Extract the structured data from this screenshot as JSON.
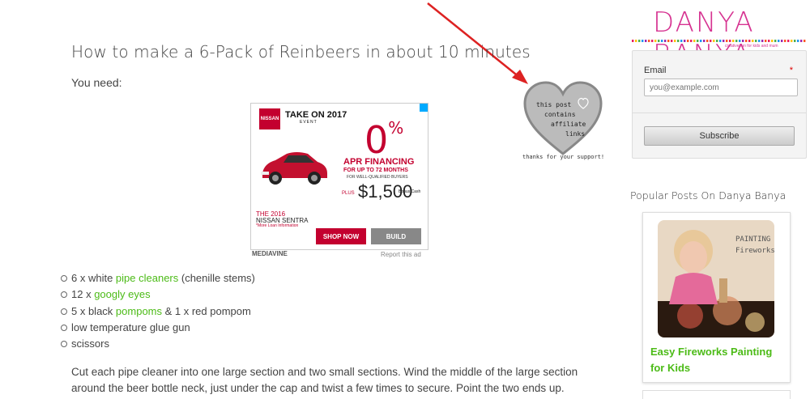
{
  "post": {
    "title": "How to make a 6-Pack of Reinbeers in about 10 minutes",
    "you_need": "You need:",
    "supplies": [
      {
        "prefix": "6 x white ",
        "link": "pipe cleaners",
        "suffix": " (chenille stems)"
      },
      {
        "prefix": "12 x ",
        "link": "googly eyes",
        "suffix": ""
      },
      {
        "prefix": "5 x black ",
        "link": "pompoms",
        "suffix": " & 1 x red pompom"
      },
      {
        "prefix": "low temperature glue gun",
        "link": "",
        "suffix": ""
      },
      {
        "prefix": "scissors",
        "link": "",
        "suffix": ""
      }
    ],
    "paragraph": "Cut each pipe cleaner into one large section and two small sections. Wind the middle of the large section around the beer bottle neck, just under the cap and twist a few times to secure. Point the two ends up."
  },
  "ad": {
    "brand": "NISSAN",
    "headline": "TAKE ON 2017",
    "event": "EVENT",
    "percent": "0",
    "percent_sign": "%",
    "apr": "APR FINANCING",
    "upto": "FOR UP TO 72 MONTHS",
    "qualified": "FOR WELL-QUALIFIED BUYERS",
    "plus": "PLUS",
    "cash": "$1,500",
    "cash_label": "Bonus Cash",
    "year": "THE 2016",
    "model": "NISSAN SENTRA",
    "more_info": "*More Loan Information",
    "shop_now": "SHOP NOW",
    "build": "BUILD",
    "network": "MEDIAVINE",
    "report": "Report this ad"
  },
  "affiliate": {
    "heart_text": [
      "this post",
      "contains",
      "affiliate",
      "links"
    ],
    "thanks": "thanks for your support!"
  },
  "sidebar": {
    "logo": "DANYA BANYA",
    "tagline": "creative fun for kids and mum",
    "email_label": "Email",
    "required": "*",
    "email_placeholder": "you@example.com",
    "subscribe": "Subscribe",
    "popular_title": "Popular Posts On Danya Banya",
    "popular_post": "Easy Fireworks Painting for Kids",
    "popular_img_text": [
      "PAINTING",
      "Fireworks"
    ]
  },
  "colors": {
    "link_green": "#4cbb17",
    "brand_pink": "#d63391",
    "nissan_red": "#c3002f",
    "arrow_red": "#d22"
  }
}
